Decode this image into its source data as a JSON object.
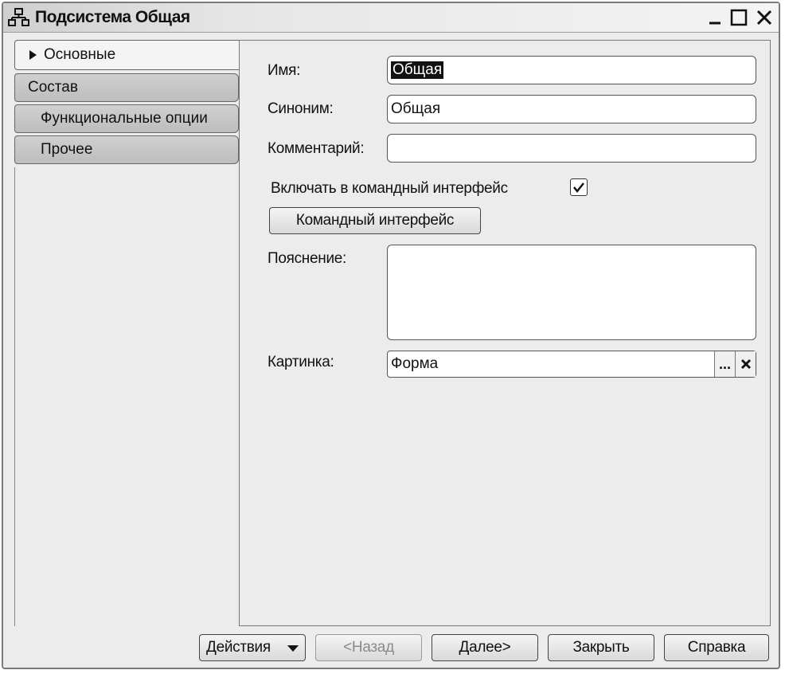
{
  "window": {
    "title": "Подсистема Общая",
    "icon": "subsystem-tree-icon"
  },
  "tabs": [
    {
      "label": "Основные",
      "active": true
    },
    {
      "label": "Состав",
      "active": false
    },
    {
      "label": "Функциональные опции",
      "active": false
    },
    {
      "label": "Прочее",
      "active": false
    }
  ],
  "form": {
    "name_label": "Имя:",
    "name_value": "Общая",
    "synonym_label": "Синоним:",
    "synonym_value": "Общая",
    "comment_label": "Комментарий:",
    "comment_value": "",
    "include_label": "Включать в командный интерфейс",
    "include_checked": true,
    "command_interface_button": "Командный интерфейс",
    "explanation_label": "Пояснение:",
    "explanation_value": "",
    "picture_label": "Картинка:",
    "picture_value": "Форма",
    "picture_select": "...",
    "picture_clear": "x"
  },
  "footer": {
    "actions": "Действия",
    "back": "<Назад",
    "next": "Далее>",
    "close": "Закрыть",
    "help": "Справка"
  }
}
